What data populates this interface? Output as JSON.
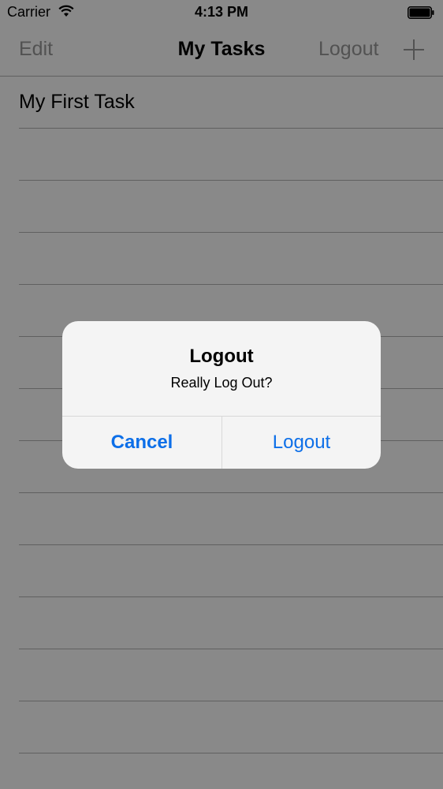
{
  "status_bar": {
    "carrier": "Carrier",
    "time": "4:13 PM",
    "wifi_icon": "wifi-icon",
    "battery_icon": "battery-icon"
  },
  "nav_bar": {
    "edit_label": "Edit",
    "title": "My Tasks",
    "logout_label": "Logout",
    "add_icon": "plus-icon"
  },
  "tasks": [
    {
      "title": "My First Task"
    },
    {
      "title": ""
    },
    {
      "title": ""
    },
    {
      "title": ""
    },
    {
      "title": ""
    },
    {
      "title": ""
    },
    {
      "title": ""
    },
    {
      "title": ""
    },
    {
      "title": ""
    },
    {
      "title": ""
    },
    {
      "title": ""
    },
    {
      "title": ""
    },
    {
      "title": ""
    },
    {
      "title": ""
    }
  ],
  "alert": {
    "title": "Logout",
    "message": "Really Log Out?",
    "cancel_label": "Cancel",
    "confirm_label": "Logout"
  },
  "colors": {
    "accent": "#0d6fe8",
    "nav_button_disabled": "#999999",
    "overlay": "rgba(0,0,0,0.46)"
  }
}
